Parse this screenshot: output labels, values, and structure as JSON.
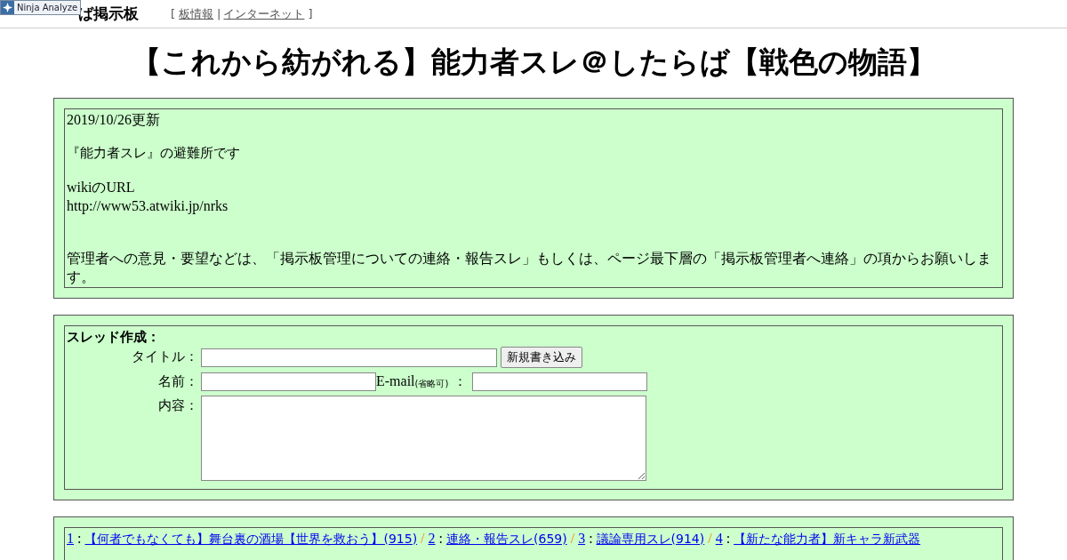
{
  "header": {
    "badge": "Ninja Analyze",
    "logo": "ば掲示板",
    "nav_open": "[",
    "nav_links": [
      "板情報",
      "インターネット"
    ],
    "nav_sep": "|",
    "nav_close": "]"
  },
  "title": "【これから紡がれる】能力者スレ＠したらば【戦色の物語】",
  "notice": {
    "lines": [
      "2019/10/26更新",
      "『能力者スレ』の避難所です",
      "wikiのURL",
      "http://www53.atwiki.jp/nrks",
      "管理者への意見・要望などは、「掲示板管理についての連絡・報告スレ」もしくは、ページ最下層の「掲示板管理者へ連絡」の項からお願いします。"
    ]
  },
  "form": {
    "heading": "スレッド作成：",
    "title_label": "タイトル：",
    "submit": "新規書き込み",
    "name_label": "名前：",
    "email_label": "E-mail",
    "email_note": "(省略可)",
    "email_colon": "：",
    "body_label": "内容："
  },
  "threads": {
    "separator": "/",
    "colon": ":",
    "items": [
      {
        "number": "1",
        "title": "【何者でもなくても】舞台裏の酒場【世界を救おう】(915)"
      },
      {
        "number": "2",
        "title": "連絡・報告スレ(659)"
      },
      {
        "number": "3",
        "title": "議論専用スレ(914)"
      },
      {
        "number": "4",
        "title": "【新たな能力者】新キャラ新武器"
      }
    ]
  }
}
